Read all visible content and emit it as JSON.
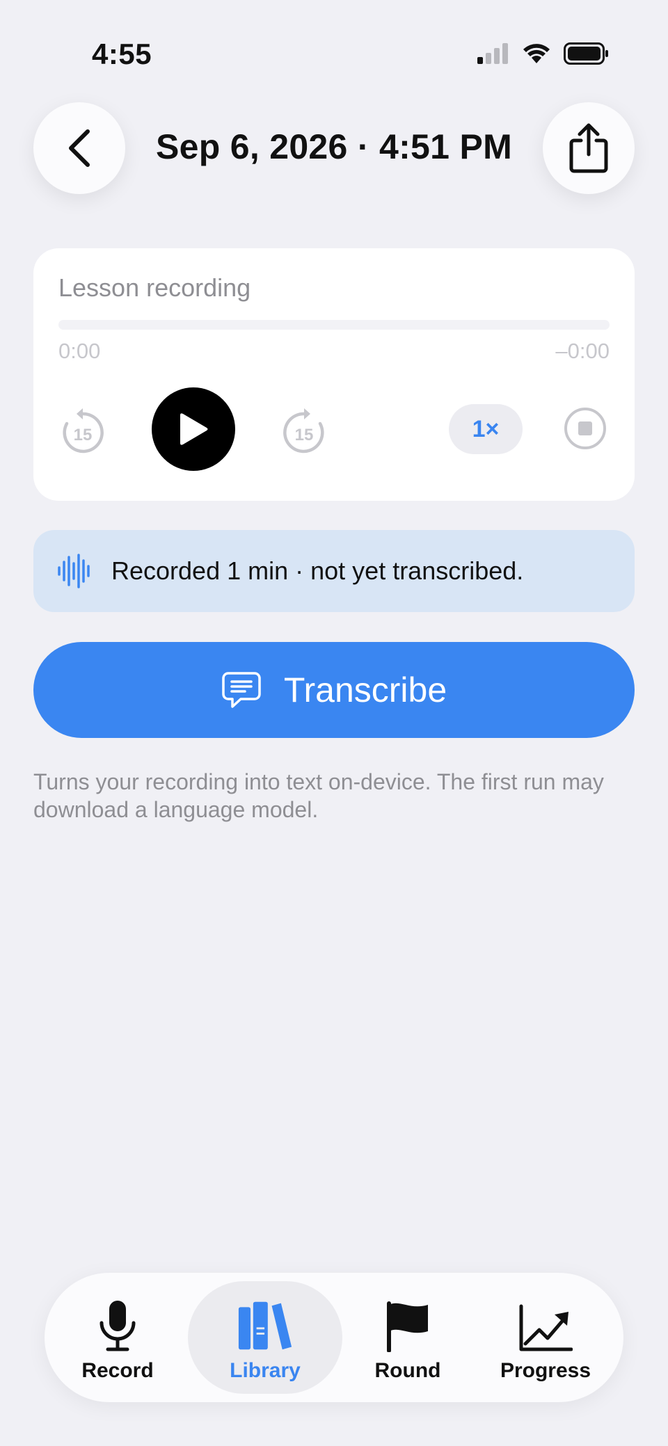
{
  "status_bar": {
    "time": "4:55"
  },
  "header": {
    "title": "Sep 6, 2026 · 4:51 PM"
  },
  "player": {
    "title": "Lesson recording",
    "elapsed": "0:00",
    "remaining": "–0:00",
    "progress_percent": 0,
    "skip_back_seconds": "15",
    "skip_forward_seconds": "15",
    "speed_label": "1×"
  },
  "banner": {
    "text": "Recorded 1 min · not yet transcribed."
  },
  "transcribe": {
    "label": "Transcribe",
    "helper": "Turns your recording into text on-device. The first run may download a language model."
  },
  "tabs": [
    {
      "label": "Record",
      "icon": "mic-icon",
      "active": false
    },
    {
      "label": "Library",
      "icon": "books-icon",
      "active": true
    },
    {
      "label": "Round",
      "icon": "flag-icon",
      "active": false
    },
    {
      "label": "Progress",
      "icon": "chart-line-icon",
      "active": false
    }
  ],
  "colors": {
    "accent": "#3a86f1",
    "background": "#f0f0f5",
    "banner": "#d8e5f5"
  }
}
